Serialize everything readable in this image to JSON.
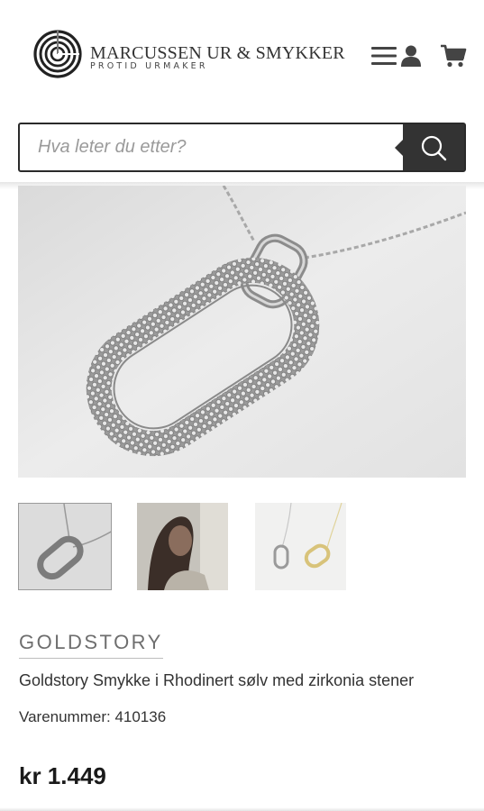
{
  "header": {
    "logo_title": "MARCUSSEN UR & SMYKKER",
    "logo_subtitle": "PROTID URMAKER",
    "icons": [
      "menu-icon",
      "user-icon",
      "cart-icon"
    ]
  },
  "search": {
    "placeholder": "Hva leter du etter?",
    "value": "",
    "button_icon": "search-icon"
  },
  "gallery": {
    "main_image": "necklace-pendant-photo",
    "thumbnails": [
      "pendant-closeup",
      "model-wearing-necklace",
      "silver-and-gold-pendants"
    ],
    "active_index": 0
  },
  "product": {
    "brand": "GOLDSTORY",
    "title": "Goldstory Smykke i Rhodinert sølv med zirkonia stener",
    "sku": "Varenummer: 410136",
    "price": "kr 1.449"
  },
  "colors": {
    "dark": "#333333",
    "brand_text": "#6e6e6e",
    "border": "#2a2a2a"
  }
}
